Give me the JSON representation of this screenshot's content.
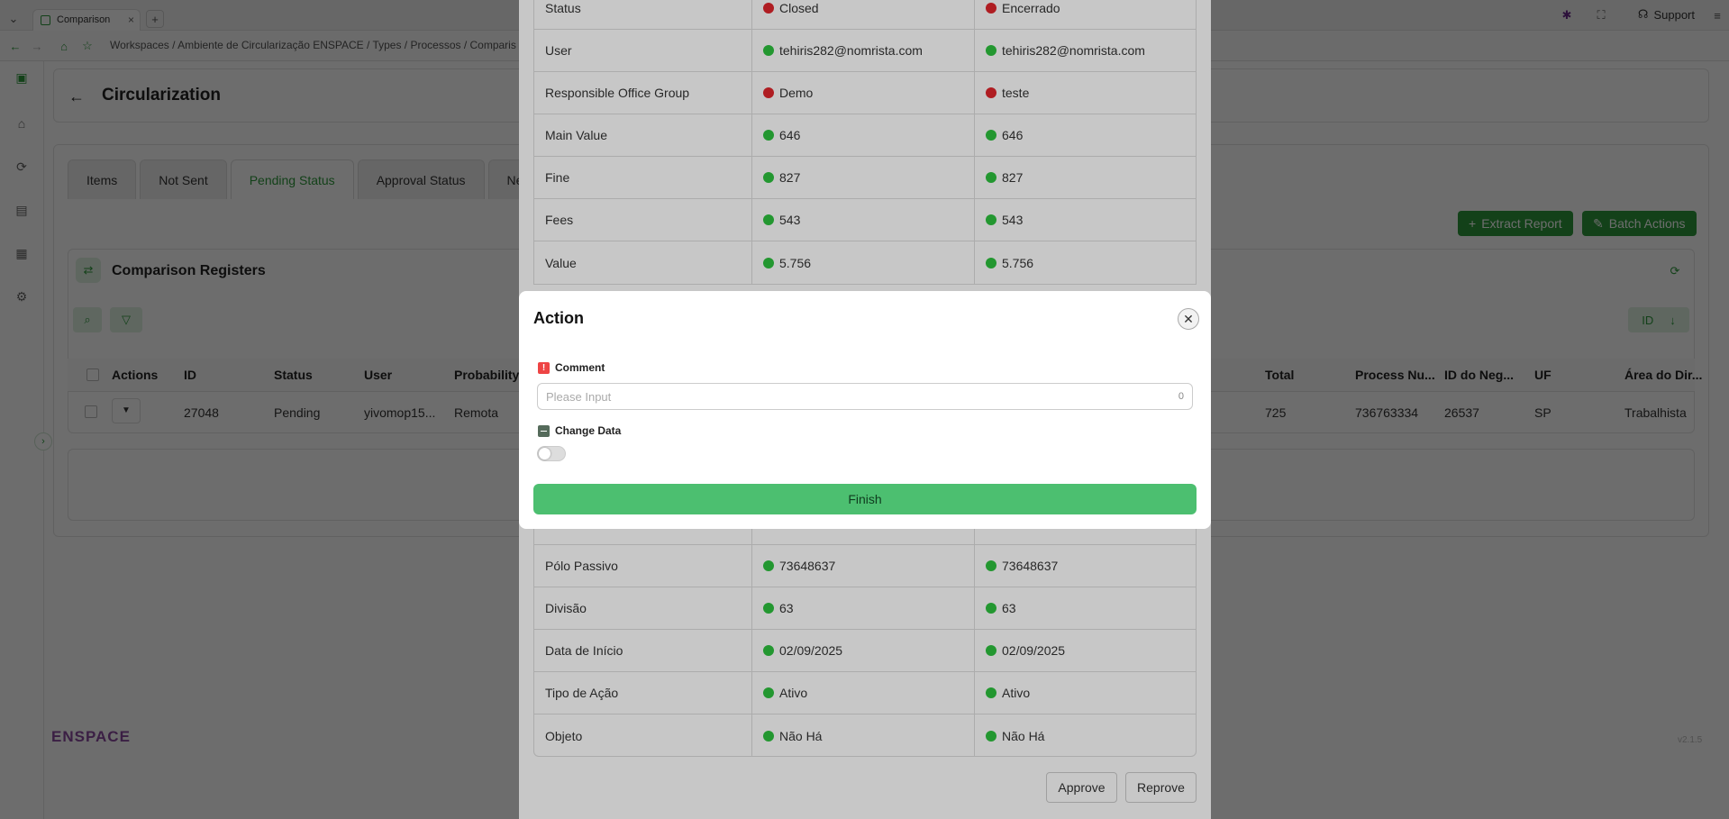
{
  "browser": {
    "tab_title": "Comparison",
    "breadcrumb": "Workspaces / Ambiente de Circularização ENSPACE / Types / Processos / Comparis",
    "support_label": "Support"
  },
  "page": {
    "title": "Circularization",
    "tabs": [
      "Items",
      "Not Sent",
      "Pending Status",
      "Approval Status",
      "Ne"
    ],
    "active_tab": "Pending Status",
    "extract_report": "Extract Report",
    "batch_actions": "Batch Actions",
    "section_title": "Comparison Registers",
    "sort_field": "ID",
    "columns_left": [
      "Actions",
      "ID",
      "Status",
      "User",
      "Probability"
    ],
    "columns_right": [
      "Total",
      "Process Nu...",
      "ID do Neg...",
      "UF",
      "Área do Dir..."
    ],
    "row_left": [
      "27048",
      "Pending",
      "yivomop15...",
      "Remota"
    ],
    "row_right": [
      "725",
      "736763334",
      "26537",
      "SP",
      "Trabalhista"
    ],
    "brand": "ENSPACE",
    "version": "v2.1.5"
  },
  "comparison": {
    "rows_top": [
      {
        "field": "Status",
        "left": "Closed",
        "left_status": "red",
        "right": "Encerrado",
        "right_status": "red"
      },
      {
        "field": "User",
        "left": "tehiris282@nomrista.com",
        "left_status": "green",
        "right": "tehiris282@nomrista.com",
        "right_status": "green"
      },
      {
        "field": "Responsible Office Group",
        "left": "Demo",
        "left_status": "red",
        "right": "teste",
        "right_status": "red"
      },
      {
        "field": "Main Value",
        "left": "646",
        "left_status": "green",
        "right": "646",
        "right_status": "green"
      },
      {
        "field": "Fine",
        "left": "827",
        "left_status": "green",
        "right": "827",
        "right_status": "green"
      },
      {
        "field": "Fees",
        "left": "543",
        "left_status": "green",
        "right": "543",
        "right_status": "green"
      },
      {
        "field": "Value",
        "left": "5.756",
        "left_status": "green",
        "right": "5.756",
        "right_status": "green"
      }
    ],
    "rows_bottom": [
      {
        "field": "Pólo Passivo",
        "left": "73648637",
        "left_status": "green",
        "right": "73648637",
        "right_status": "green"
      },
      {
        "field": "Divisão",
        "left": "63",
        "left_status": "green",
        "right": "63",
        "right_status": "green"
      },
      {
        "field": "Data de Início",
        "left": "02/09/2025",
        "left_status": "green",
        "right": "02/09/2025",
        "right_status": "green"
      },
      {
        "field": "Tipo de Ação",
        "left": "Ativo",
        "left_status": "green",
        "right": "Ativo",
        "right_status": "green"
      },
      {
        "field": "Objeto",
        "left": "Não Há",
        "left_status": "green",
        "right": "Não Há",
        "right_status": "green"
      }
    ],
    "approve_label": "Approve",
    "reprove_label": "Reprove"
  },
  "dialog": {
    "title": "Action",
    "comment_label": "Comment",
    "comment_placeholder": "Please Input",
    "comment_count": "0",
    "change_data_label": "Change Data",
    "change_data_on": false,
    "finish_label": "Finish"
  }
}
